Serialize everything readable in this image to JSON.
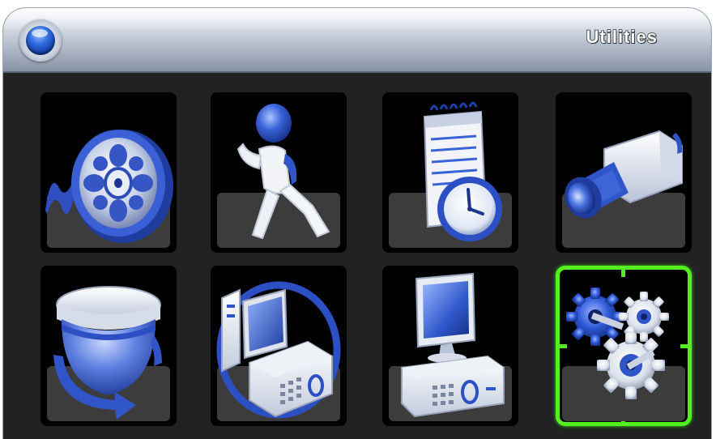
{
  "window": {
    "title": "Utilities"
  },
  "menu": {
    "selected_index": 7,
    "items": [
      {
        "icon": "film-reel-icon"
      },
      {
        "icon": "running-man-icon"
      },
      {
        "icon": "schedule-icon"
      },
      {
        "icon": "camera-icon"
      },
      {
        "icon": "ptz-dome-camera-icon"
      },
      {
        "icon": "network-device-icon"
      },
      {
        "icon": "computer-dvr-icon"
      },
      {
        "icon": "gears-icon"
      }
    ]
  },
  "colors": {
    "selection": "#52f01e",
    "accent_blue": "#2f55c8"
  }
}
